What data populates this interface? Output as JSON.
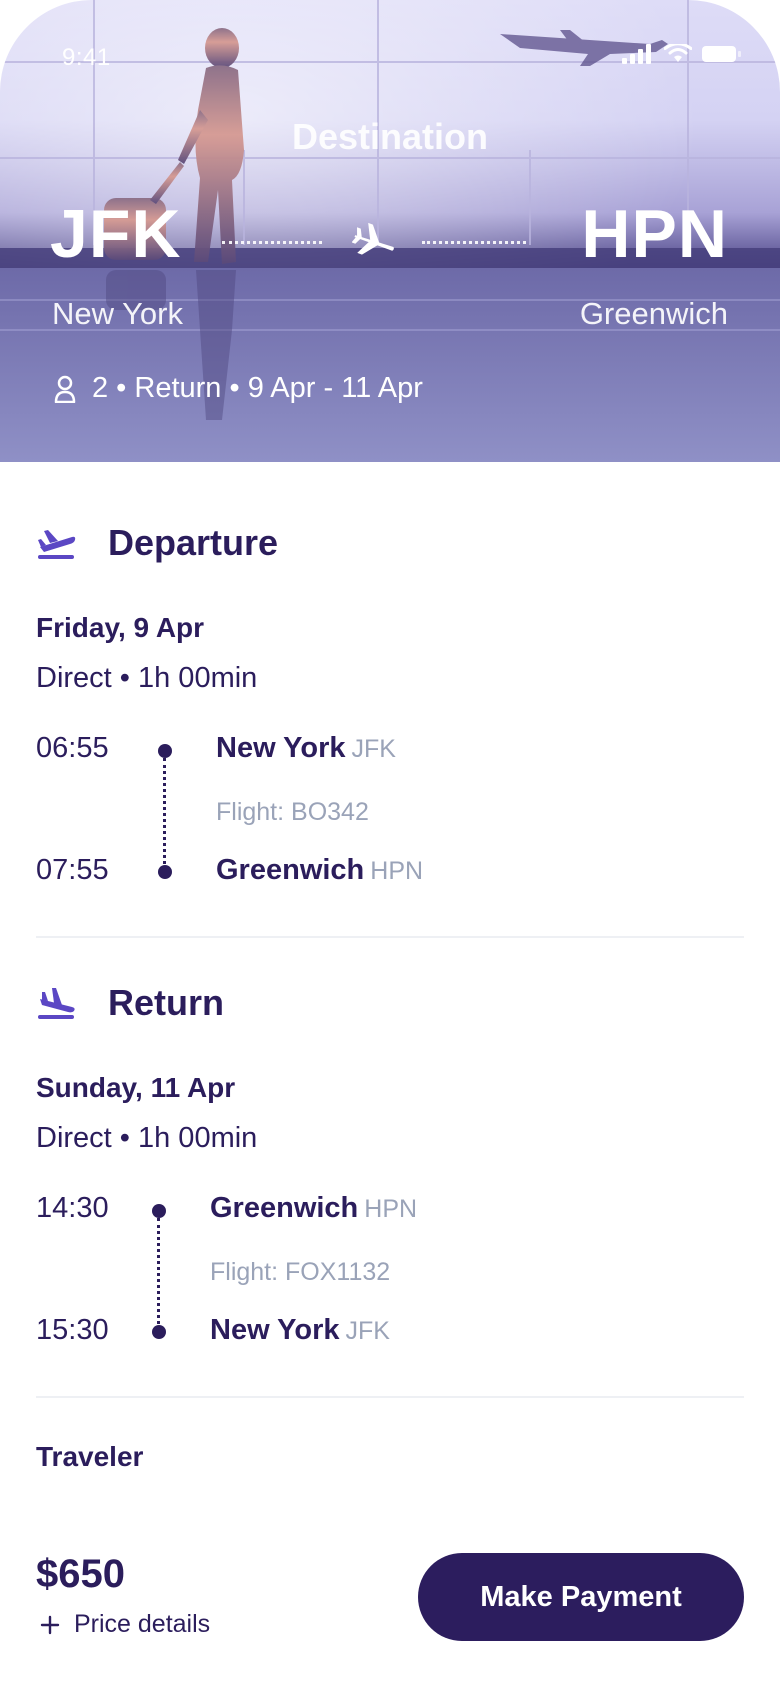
{
  "status_bar": {
    "time": "9:41"
  },
  "hero": {
    "title": "Destination",
    "from": {
      "code": "JFK",
      "city": "New York"
    },
    "to": {
      "code": "HPN",
      "city": "Greenwich"
    },
    "summary": "2 • Return • 9 Apr - 11 Apr"
  },
  "departure": {
    "title": "Departure",
    "date": "Friday, 9 Apr",
    "duration": "Direct • 1h 00min",
    "stops": [
      {
        "time": "06:55",
        "city": "New York",
        "code": "JFK"
      },
      {
        "time": "07:55",
        "city": "Greenwich",
        "code": "HPN"
      }
    ],
    "flight": "Flight: BO342"
  },
  "return": {
    "title": "Return",
    "date": "Sunday, 11 Apr",
    "duration": "Direct • 1h 00min",
    "stops": [
      {
        "time": "14:30",
        "city": "Greenwich",
        "code": "HPN"
      },
      {
        "time": "15:30",
        "city": "New York",
        "code": "JFK"
      }
    ],
    "flight": "Flight: FOX1132"
  },
  "traveler": {
    "title": "Traveler"
  },
  "footer": {
    "price": "$650",
    "price_details": "Price details",
    "pay_label": "Make Payment"
  },
  "icons": {
    "status": [
      "signal-icon",
      "wifi-icon",
      "battery-icon"
    ],
    "route": "airplane-icon",
    "summary": "person-icon",
    "departure": "flight-takeoff-icon",
    "return": "flight-land-icon",
    "price_details": "plus-icon"
  },
  "colors": {
    "primary": "#2c1d5e",
    "muted": "#9aa3b8",
    "divider": "#eef0f4"
  }
}
